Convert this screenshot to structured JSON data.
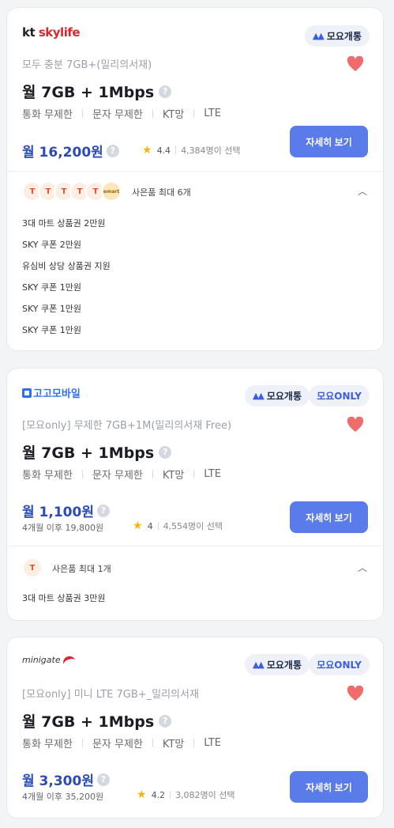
{
  "cards": [
    {
      "carrier": "kt skylife",
      "carrier_parts": {
        "k": "kt",
        "rest": " skylife"
      },
      "badges": [
        "모요개통"
      ],
      "subtitle": "모두 충분 7GB+(밀리의서재)",
      "title": "월 7GB + 1Mbps",
      "features": [
        "통화 무제한",
        "문자 무제한",
        "KT망",
        "LTE"
      ],
      "price": "월 16,200원",
      "price_sub": "",
      "rating": "4.4",
      "review_count": "4,384명이 선택",
      "button": "자세히 보기",
      "gift_summary": "사은품 최대 6개",
      "gift_icons": [
        "T",
        "T",
        "T",
        "T",
        "T",
        "emart"
      ],
      "gifts": [
        "3대 마트 상품권 2만원",
        "SKY 쿠폰 2만원",
        "유심비 상당 상품권 지원",
        "SKY 쿠폰 1만원",
        "SKY 쿠폰 1만원",
        "SKY 쿠폰 1만원"
      ],
      "favorite": true
    },
    {
      "carrier": "고고모바일",
      "badges": [
        "모요개통",
        "모요ONLY"
      ],
      "subtitle": "[모요only] 무제한 7GB+1M(밀리의서재 Free)",
      "title": "월 7GB + 1Mbps",
      "features": [
        "통화 무제한",
        "문자 무제한",
        "KT망",
        "LTE"
      ],
      "price": "월 1,100원",
      "price_sub": "4개월 이후 19,800원",
      "rating": "4",
      "review_count": "4,554명이 선택",
      "button": "자세히 보기",
      "gift_summary": "사은품 최대 1개",
      "gift_icons": [
        "T"
      ],
      "gifts": [
        "3대 마트 상품권 3만원"
      ],
      "favorite": true
    },
    {
      "carrier": "minigate",
      "badges": [
        "모요개통",
        "모요ONLY"
      ],
      "subtitle": "[모요only] 미니 LTE 7GB+_밀리의서재",
      "title": "월 7GB + 1Mbps",
      "features": [
        "통화 무제한",
        "문자 무제한",
        "KT망",
        "LTE"
      ],
      "price": "월 3,300원",
      "price_sub": "4개월 이후 35,200원",
      "rating": "4.2",
      "review_count": "3,082명이 선택",
      "button": "자세히 보기",
      "favorite": true
    }
  ],
  "colors": {
    "accent": "#5a7bea",
    "price": "#2b4bb8",
    "heart": "#f06b6b",
    "star": "#f5b50a"
  },
  "icons": {
    "heart": "heart-icon",
    "moyo": "moyo-logo-icon",
    "question": "question-icon",
    "star": "star-icon",
    "chevron": "chevron-up-icon"
  }
}
